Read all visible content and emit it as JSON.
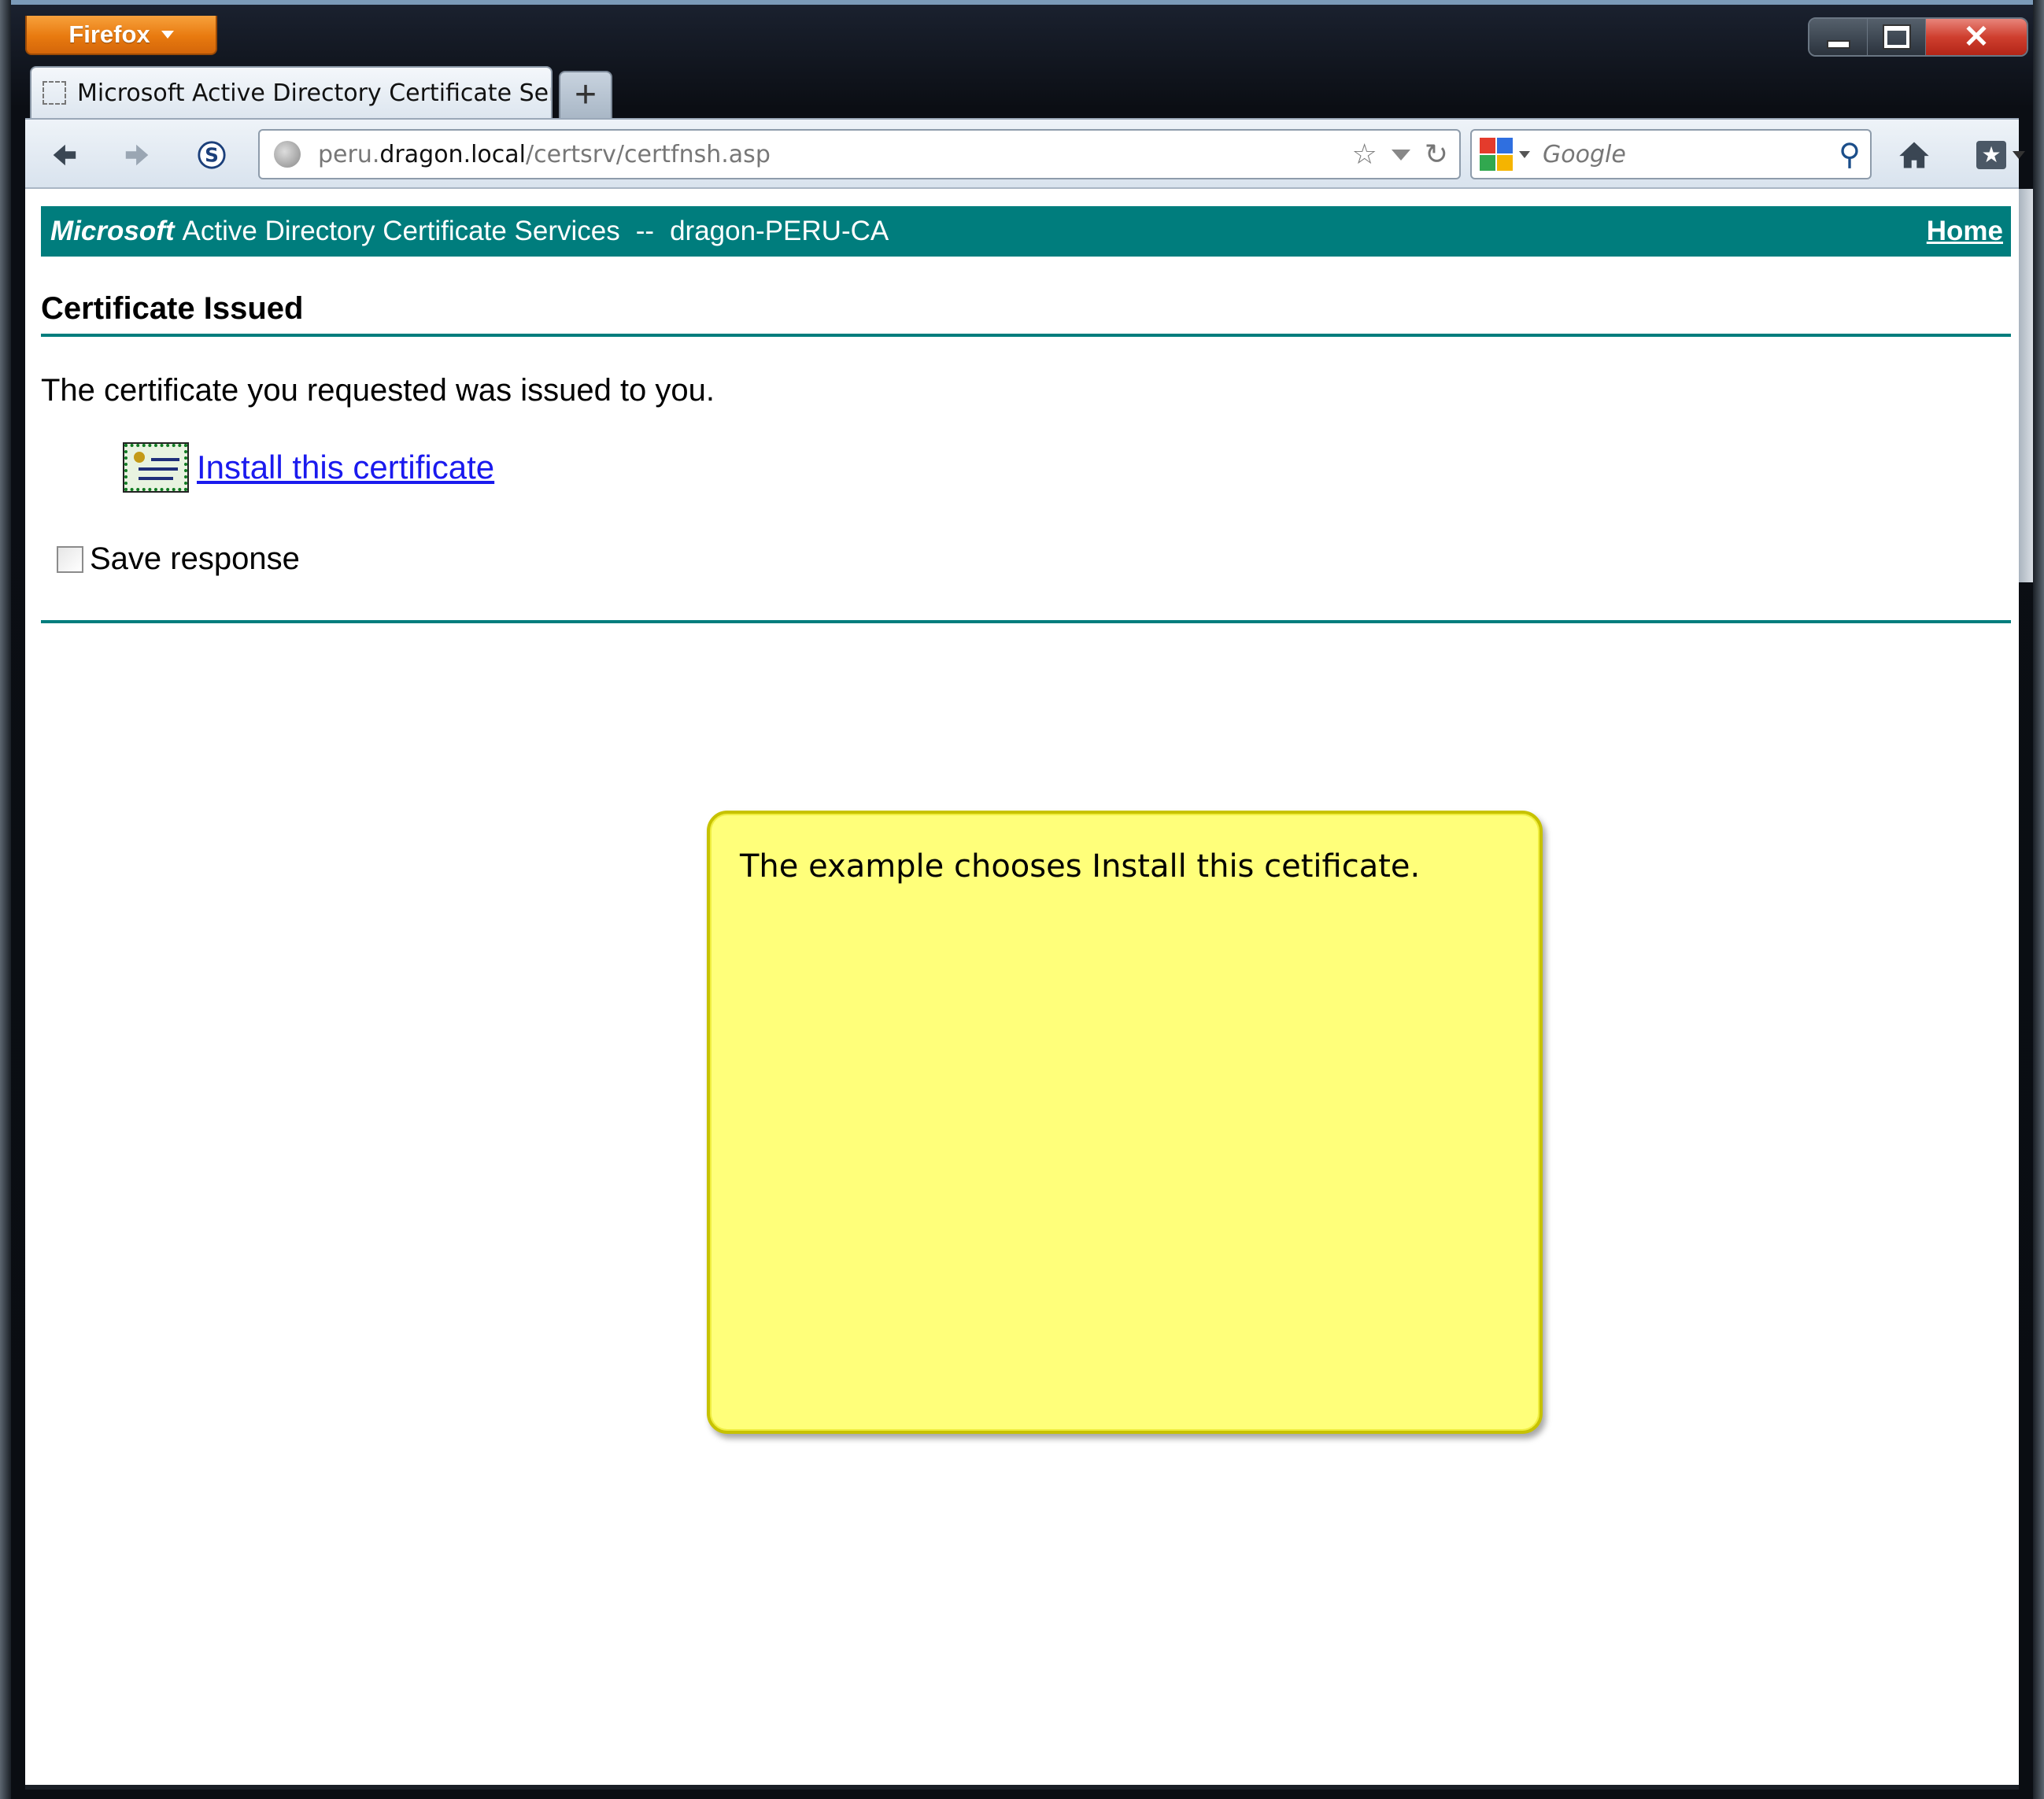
{
  "window": {
    "app_button_label": "Firefox"
  },
  "tabs": [
    {
      "label": "Microsoft Active Directory Certificate Ser..."
    }
  ],
  "new_tab_label": "+",
  "toolbar": {
    "url": {
      "subdomain": "peru.",
      "domain": "dragon.local",
      "path": "/certsrv/certfnsh.asp"
    },
    "search": {
      "engine": "Google",
      "placeholder": "Google"
    },
    "icons": {
      "back": "back-arrow-icon",
      "forward": "forward-arrow-icon",
      "sync": "sync-icon",
      "bookmark_star": "star-icon",
      "reload": "reload-icon",
      "home": "home-icon",
      "bookmarks": "bookmarks-icon"
    }
  },
  "page": {
    "banner": {
      "brand": "Microsoft",
      "service": "Active Directory Certificate Services",
      "separator": "--",
      "ca_name": "dragon-PERU-CA",
      "home_link": "Home"
    },
    "title": "Certificate Issued",
    "issued_text": "The certificate you requested was issued to you.",
    "install_link": "Install this certificate",
    "save_response_label": "Save response",
    "save_response_checked": false
  },
  "callout": {
    "text": "The example chooses Install this cetificate."
  },
  "colors": {
    "banner_teal": "#007d7d",
    "callout_yellow": "#ffff7a",
    "link_blue": "#1a1aee",
    "firefox_orange": "#e87a0f",
    "close_red": "#cf3f2f"
  }
}
